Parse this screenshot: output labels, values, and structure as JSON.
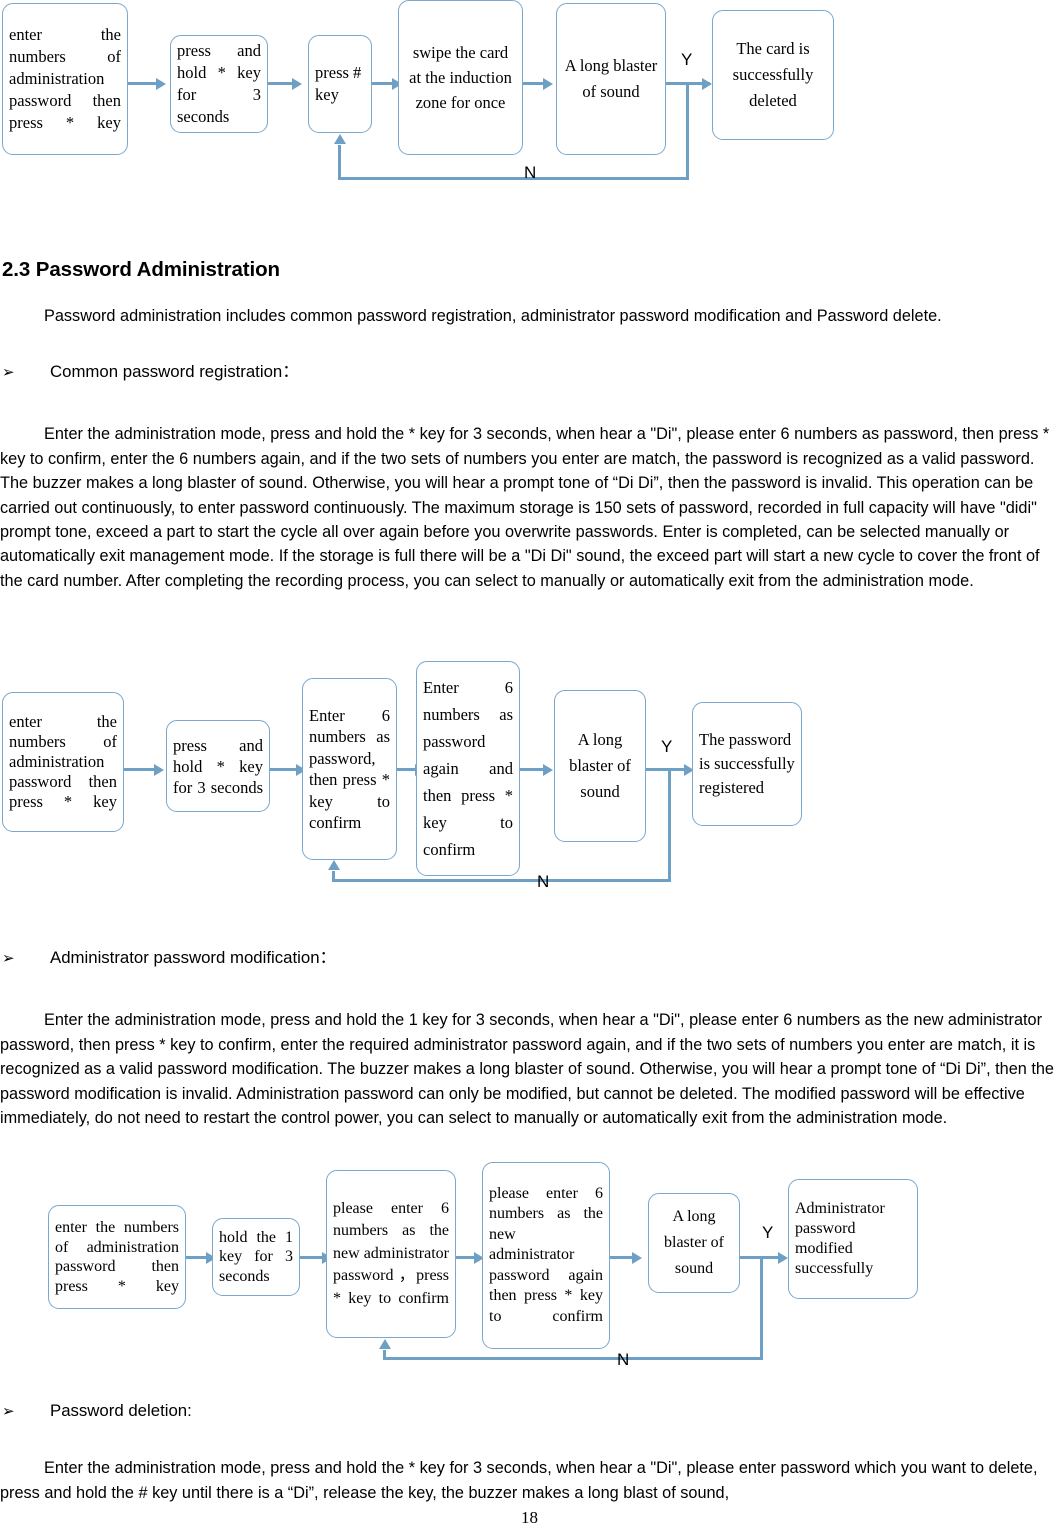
{
  "document": {
    "page_number": "18",
    "heading": "2.3 Password Administration",
    "intro_paragraph": "Password administration includes common password registration, administrator password modification and Password delete.",
    "bullet_glyph": "➢"
  },
  "colors": {
    "flow_border": "#7BA7CC",
    "flow_line": "#6E9FC4",
    "text": "#000000",
    "page_background": "#FFFFFF"
  },
  "flow_card_delete": {
    "name": "card deletion flow",
    "boxes": [
      {
        "text": "enter the numbers of administration password then press * key"
      },
      {
        "text": "press and hold * key for 3 seconds"
      },
      {
        "text": "press # key"
      },
      {
        "text": "swipe the card at the induction zone for once"
      },
      {
        "text": "A long blaster of sound"
      },
      {
        "text": "The card is successfully deleted"
      }
    ],
    "yes_label": "Y",
    "no_label": "N"
  },
  "sections": [
    {
      "id": "common-password-registration",
      "bullet_title": "Common password registration：",
      "paragraph": "Enter the administration mode, press and hold the * key for 3 seconds, when hear a \"Di\", please enter 6 numbers as password, then press * key to confirm, enter the 6 numbers again, and if the two sets of numbers you enter are match, the password is recognized as a valid password. The buzzer makes a long blaster of sound. Otherwise, you will hear a prompt tone of “Di Di”, then the password is invalid. This operation can be carried out continuously, to enter password continuously. The maximum storage is 150 sets of password, recorded in full capacity will have \"didi\" prompt tone, exceed a part to start the cycle all over again before you overwrite passwords. Enter is completed, can be selected manually or automatically exit management mode. If the storage is full there will be a \"Di Di\" sound, the exceed part will start a new cycle to cover the front of the card number. After completing the recording process, you can select to manually or automatically exit from the administration mode."
    },
    {
      "id": "administrator-password-modification",
      "bullet_title": "Administrator password modification：",
      "paragraph": "Enter the administration mode, press and hold the 1 key for 3 seconds, when hear a \"Di\", please enter 6 numbers as the new administrator password, then press * key to confirm, enter the required administrator password again, and if the two sets of numbers you enter are match, it is recognized as a valid password modification. The buzzer makes a long blaster of sound. Otherwise, you will hear a prompt tone of “Di Di”, then the password modification is invalid.    Administration password can only be modified, but cannot be deleted. The modified password will be effective immediately, do not need to restart the control power, you can select to manually or automatically exit from the administration mode."
    },
    {
      "id": "password-deletion",
      "bullet_title": "Password deletion:",
      "paragraph": "Enter the administration mode, press and hold the * key for 3 seconds, when hear a \"Di\", please enter password which you want to delete, press and hold the # key until there is a “Di”, release the key, the buzzer makes a long blast of sound,"
    }
  ],
  "flow_password_register": {
    "name": "common password registration flow",
    "boxes": [
      {
        "text": "enter the numbers of administration password then press * key"
      },
      {
        "text": "press and hold * key for 3 seconds"
      },
      {
        "text": "Enter 6 numbers as password, then press * key to confirm"
      },
      {
        "text": "Enter 6 numbers as password again and then press * key to confirm"
      },
      {
        "text": "A long blaster of sound"
      },
      {
        "text": "The password is successfully registered"
      }
    ],
    "yes_label": "Y",
    "no_label": "N"
  },
  "flow_admin_modify": {
    "name": "administrator password modification flow",
    "boxes": [
      {
        "text": "enter the numbers of administration password then press * key"
      },
      {
        "text": "hold the 1 key for 3 seconds"
      },
      {
        "text": "please enter 6 numbers as the new administrator password ，press * key to confirm"
      },
      {
        "text": "please enter 6 numbers as the new administrator password again then press * key to confirm"
      },
      {
        "text": "A long blaster of sound"
      },
      {
        "text": "Administrator password modified successfully"
      }
    ],
    "yes_label": "Y",
    "no_label": "N"
  }
}
